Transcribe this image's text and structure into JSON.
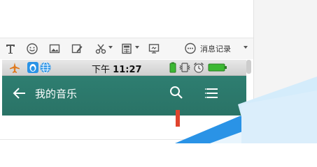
{
  "chat_window": {
    "toolbar": {
      "buttons": [
        {
          "name": "text-format",
          "icon": "text-format-icon"
        },
        {
          "name": "emoji",
          "icon": "smiley-icon"
        },
        {
          "name": "image",
          "icon": "image-icon"
        },
        {
          "name": "screenshot-edit",
          "icon": "pencil-frame-icon"
        },
        {
          "name": "screenshot",
          "icon": "scissors-icon"
        },
        {
          "name": "more-apps",
          "icon": "calculator-icon"
        },
        {
          "name": "screen-share",
          "icon": "monitor-icon"
        }
      ],
      "history_icon": "chat-bubble-icon",
      "history_label": "消息记录"
    }
  },
  "phone": {
    "status_bar": {
      "time_prefix": "下午",
      "time": "11:27",
      "left_icons": [
        "airplane-icon",
        "qq-penguin-icon",
        "globe-icon"
      ],
      "right_icons": [
        "battery-small-icon",
        "vibrate-icon",
        "alarm-icon",
        "battery-icon"
      ]
    },
    "app_bar": {
      "title": "我的音乐",
      "back_icon": "back-arrow-icon",
      "search_icon": "search-icon",
      "menu_icon": "list-menu-icon",
      "background_color": "#2e7f72"
    }
  },
  "colors": {
    "accent_blue": "#2a93e6",
    "status_green": "#3cb833",
    "alarm_red": "#e0442e"
  }
}
